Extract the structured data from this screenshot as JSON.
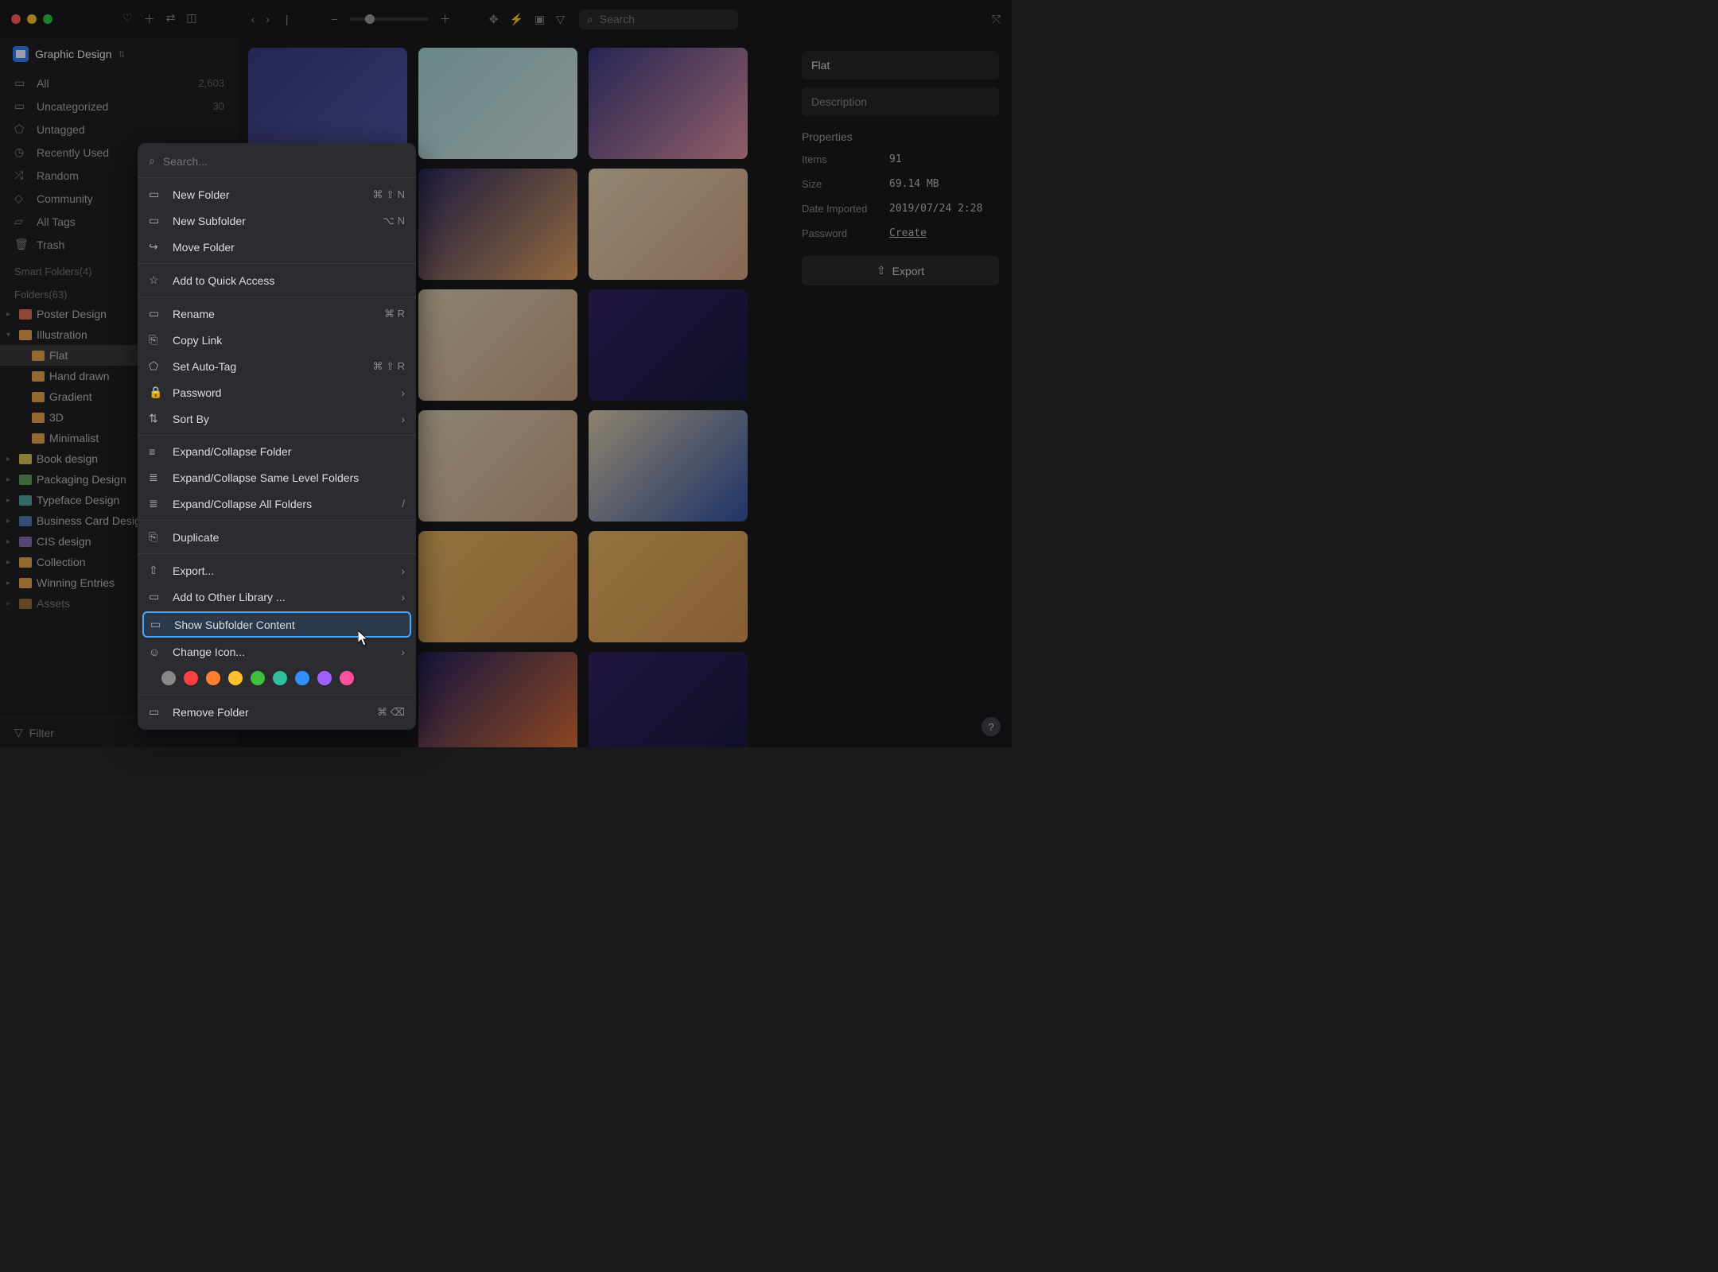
{
  "titlebar": {
    "search_placeholder": "Search"
  },
  "library": {
    "name": "Graphic Design"
  },
  "nav": {
    "all": {
      "label": "All",
      "count": "2,603"
    },
    "uncategorized": {
      "label": "Uncategorized",
      "count": "30"
    },
    "untagged": {
      "label": "Untagged"
    },
    "recent": {
      "label": "Recently Used"
    },
    "random": {
      "label": "Random"
    },
    "community": {
      "label": "Community"
    },
    "tags": {
      "label": "All Tags"
    },
    "trash": {
      "label": "Trash"
    }
  },
  "sections": {
    "smart": "Smart Folders(4)",
    "folders": "Folders(63)"
  },
  "folders": {
    "poster": "Poster Design",
    "illustration": "Illustration",
    "flat": "Flat",
    "hand": "Hand drawn",
    "gradient": "Gradient",
    "threed": "3D",
    "minimalist": "Minimalist",
    "book": "Book design",
    "packaging": "Packaging Design",
    "typeface": "Typeface Design",
    "businesscard": "Business Card Design",
    "cis": "CIS design",
    "collection": "Collection",
    "winning": "Winning Entries",
    "assets": "Assets"
  },
  "filter_label": "Filter",
  "panel": {
    "title": "Flat",
    "desc_placeholder": "Description",
    "props_label": "Properties",
    "items_k": "Items",
    "items_v": "91",
    "size_k": "Size",
    "size_v": "69.14 MB",
    "date_k": "Date Imported",
    "date_v": "2019/07/24 2:28",
    "pass_k": "Password",
    "pass_v": "Create",
    "export": "Export"
  },
  "cm": {
    "search_placeholder": "Search...",
    "new_folder": "New Folder",
    "new_folder_sc": "⌘ ⇧ N",
    "new_subfolder": "New Subfolder",
    "new_subfolder_sc": "⌥ N",
    "move": "Move Folder",
    "quick": "Add to Quick Access",
    "rename": "Rename",
    "rename_sc": "⌘ R",
    "copylink": "Copy Link",
    "autotag": "Set Auto-Tag",
    "autotag_sc": "⌘ ⇧ R",
    "password": "Password",
    "sortby": "Sort By",
    "expand1": "Expand/Collapse Folder",
    "expand2": "Expand/Collapse Same Level Folders",
    "expand3": "Expand/Collapse All Folders",
    "expand3_sc": "/",
    "duplicate": "Duplicate",
    "export": "Export...",
    "addother": "Add to Other Library ...",
    "showsub": "Show Subfolder Content",
    "changeicon": "Change Icon...",
    "remove": "Remove Folder",
    "remove_sc": "⌘ ⌫"
  },
  "cm_colors": [
    "#888",
    "#ff4040",
    "#ff8030",
    "#ffc030",
    "#40c040",
    "#30c0a0",
    "#3090ff",
    "#a060ff",
    "#ff50a0"
  ]
}
